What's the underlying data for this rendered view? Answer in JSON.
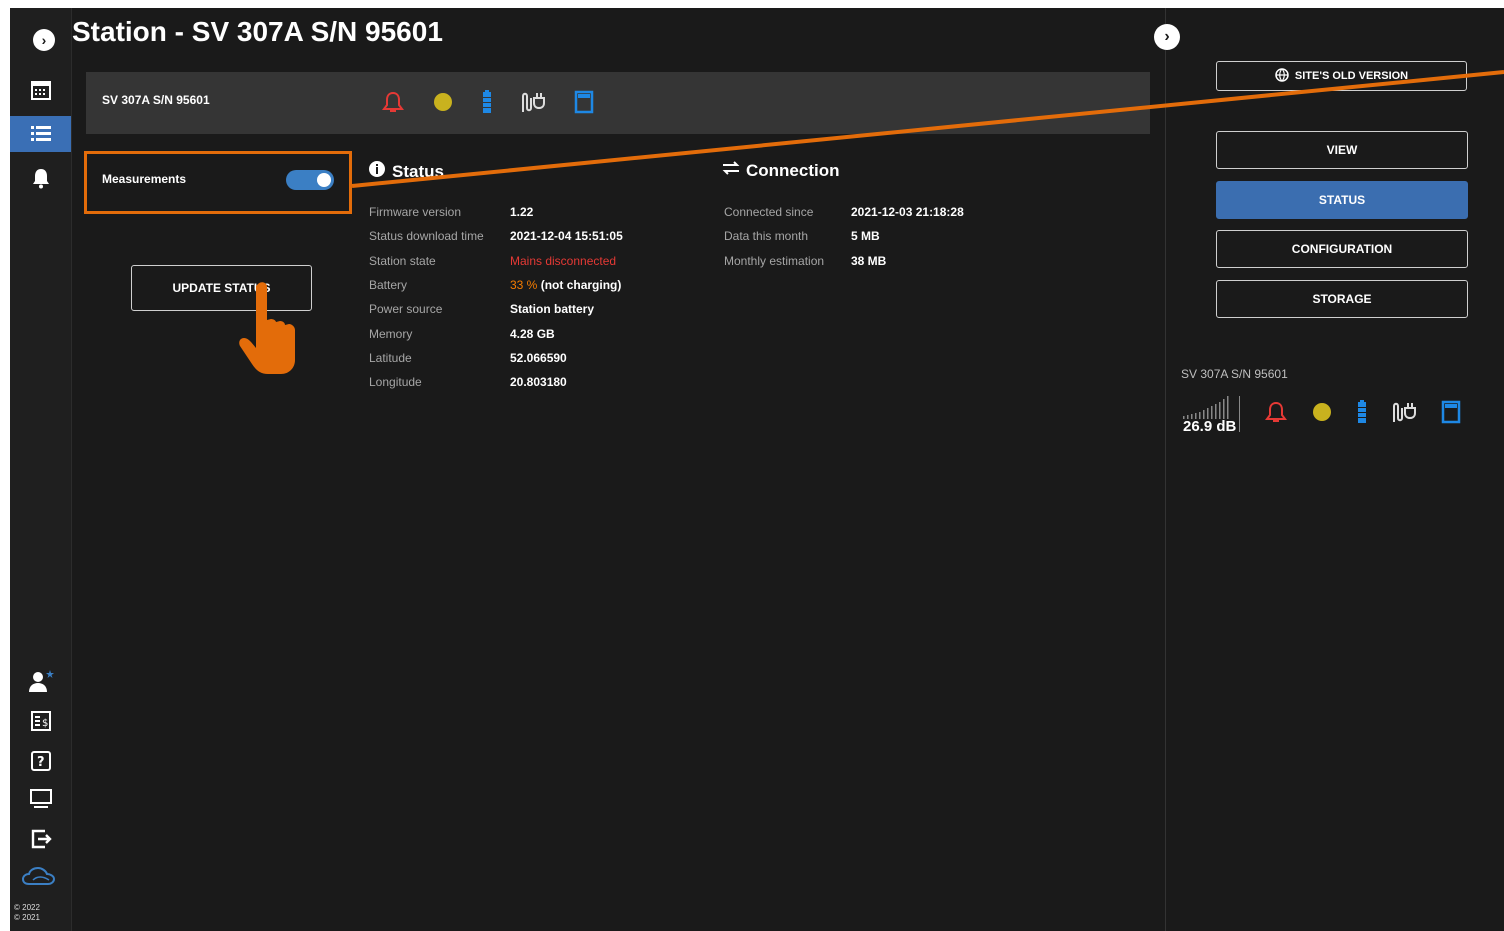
{
  "header": {
    "title": "Station - SV 307A S/N 95601"
  },
  "station_bar": {
    "name": "SV 307A S/N 95601",
    "icons": [
      "bell-alarm-icon",
      "status-dot-icon",
      "battery-icon",
      "plug-icon",
      "sd-card-icon"
    ]
  },
  "measurements": {
    "label": "Measurements",
    "enabled": true
  },
  "update_button": {
    "label": "UPDATE STATUS"
  },
  "status": {
    "heading": "Status",
    "rows": [
      {
        "key": "Firmware version",
        "value": "1.22"
      },
      {
        "key": "Status download time",
        "value": "2021-12-04 15:51:05"
      },
      {
        "key": "Station state",
        "value": "Mains disconnected"
      },
      {
        "key": "Battery",
        "value_pct": "33 %",
        "value": "(not charging)"
      },
      {
        "key": "Power source",
        "value": "Station battery"
      },
      {
        "key": "Memory",
        "value": "4.28 GB"
      },
      {
        "key": "Latitude",
        "value": "52.066590"
      },
      {
        "key": "Longitude",
        "value": "20.803180"
      }
    ]
  },
  "connection": {
    "heading": "Connection",
    "rows": [
      {
        "key": "Connected since",
        "value": "2021-12-03 21:18:28"
      },
      {
        "key": "Data this month",
        "value": "5 MB"
      },
      {
        "key": "Monthly estimation",
        "value": "38 MB"
      }
    ]
  },
  "right_panel": {
    "site_old_version": "SITE'S OLD VERSION",
    "buttons": [
      "VIEW",
      "STATUS",
      "CONFIGURATION",
      "STORAGE"
    ],
    "active_button": "STATUS",
    "station_name": "SV 307A S/N 95601",
    "signal": "26.9 dB"
  },
  "sidebar": {
    "top_items": [
      "calendar-icon",
      "list-icon",
      "bell-icon"
    ],
    "active": "list-icon",
    "bottom_items": [
      "user-icon",
      "invoice-icon",
      "help-icon",
      "monitor-icon",
      "logout-icon",
      "cloud-logo-icon"
    ],
    "copyright": [
      "© 2022",
      "© 2021"
    ]
  },
  "colors": {
    "accent": "#3b6eb0",
    "highlight": "#e36c0a",
    "alert": "#e53935",
    "warn": "#f57c00",
    "dot": "#c9b21e",
    "blue": "#1e88e5"
  }
}
